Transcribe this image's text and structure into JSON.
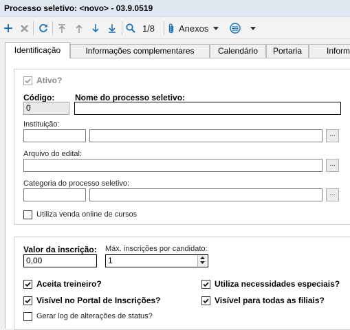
{
  "window": {
    "title": "Processo seletivo: <novo> - 03.9.0519"
  },
  "toolbar": {
    "record_position": "1/8",
    "attachments_label": "Anexos"
  },
  "tabs": [
    {
      "label": "Identificação",
      "active": true
    },
    {
      "label": "Informações complementares",
      "active": false
    },
    {
      "label": "Calendário",
      "active": false
    },
    {
      "label": "Portaria",
      "active": false
    },
    {
      "label": "Informa",
      "active": false
    }
  ],
  "form": {
    "ativo": {
      "label": "Ativo?",
      "checked": true,
      "disabled": true
    },
    "codigo": {
      "label": "Código:",
      "value": "0"
    },
    "nome": {
      "label": "Nome do processo seletivo:",
      "value": ""
    },
    "instituicao": {
      "label": "Instituição:",
      "code": "",
      "name": ""
    },
    "arquivo_edital": {
      "label": "Arquivo do edital:",
      "value": ""
    },
    "categoria": {
      "label": "Categoria do processo seletivo:",
      "code": "",
      "name": ""
    },
    "venda_online": {
      "label": "Utiliza venda online de cursos",
      "checked": false
    },
    "browse_label": "..."
  },
  "inscricao": {
    "valor": {
      "label": "Valor da inscrição:",
      "value": "0,00"
    },
    "max_inscricoes": {
      "label": "Máx. inscrições por candidato:",
      "value": "1"
    },
    "aceita_treineiro": {
      "label": "Aceita treineiro?",
      "checked": true
    },
    "necessidades_especiais": {
      "label": "Utiliza necessidades especiais?",
      "checked": true
    },
    "visivel_portal": {
      "label": "Visível no Portal de Inscrições?",
      "checked": true
    },
    "visivel_filiais": {
      "label": "Visível para todas as filiais?",
      "checked": true
    },
    "gerar_log": {
      "label": "Gerar log de alterações de status?",
      "checked": false
    }
  },
  "colors": {
    "toolbar_icon": "#1f6fb3",
    "disabled_icon": "#9a9a9a",
    "title_bg": "#dfe7f1"
  }
}
